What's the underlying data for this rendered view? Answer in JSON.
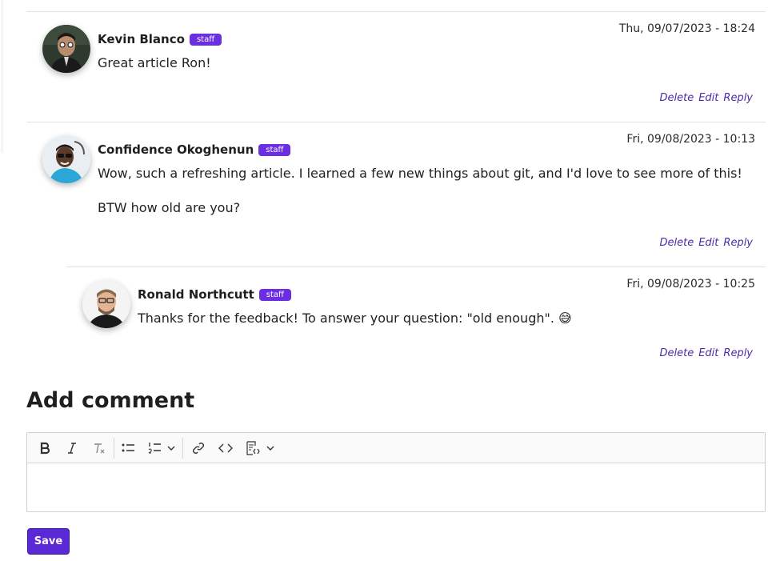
{
  "comments": [
    {
      "author": "Kevin Blanco",
      "badge": "staff",
      "date": "Thu, 09/07/2023 - 18:24",
      "paragraphs": [
        "Great article Ron!"
      ],
      "actions": {
        "delete": "Delete",
        "edit": "Edit",
        "reply": "Reply"
      }
    },
    {
      "author": "Confidence Okoghenun",
      "badge": "staff",
      "date": "Fri, 09/08/2023 - 10:13",
      "paragraphs": [
        "Wow, such a refreshing article. I learned a few new things about git, and I'd love to see more of this!",
        "BTW how old are you?"
      ],
      "actions": {
        "delete": "Delete",
        "edit": "Edit",
        "reply": "Reply"
      }
    },
    {
      "author": "Ronald Northcutt",
      "badge": "staff",
      "date": "Fri, 09/08/2023 - 10:25",
      "paragraphs": [
        "Thanks for the feedback! To answer your question: \"old enough\". 😅"
      ],
      "actions": {
        "delete": "Delete",
        "edit": "Edit",
        "reply": "Reply"
      }
    }
  ],
  "add_comment": {
    "title": "Add comment",
    "save_label": "Save",
    "toolbar": [
      "bold-icon",
      "italic-icon",
      "remove-format-icon",
      "bulleted-list-icon",
      "numbered-list-icon",
      "chevron-down-icon",
      "link-icon",
      "code-icon",
      "code-block-icon",
      "chevron-down-icon"
    ]
  },
  "colors": {
    "accent": "#5b28d6",
    "badge": "#6b2ee0",
    "link": "#4b2aa8",
    "separator": "#e2e2e2"
  }
}
